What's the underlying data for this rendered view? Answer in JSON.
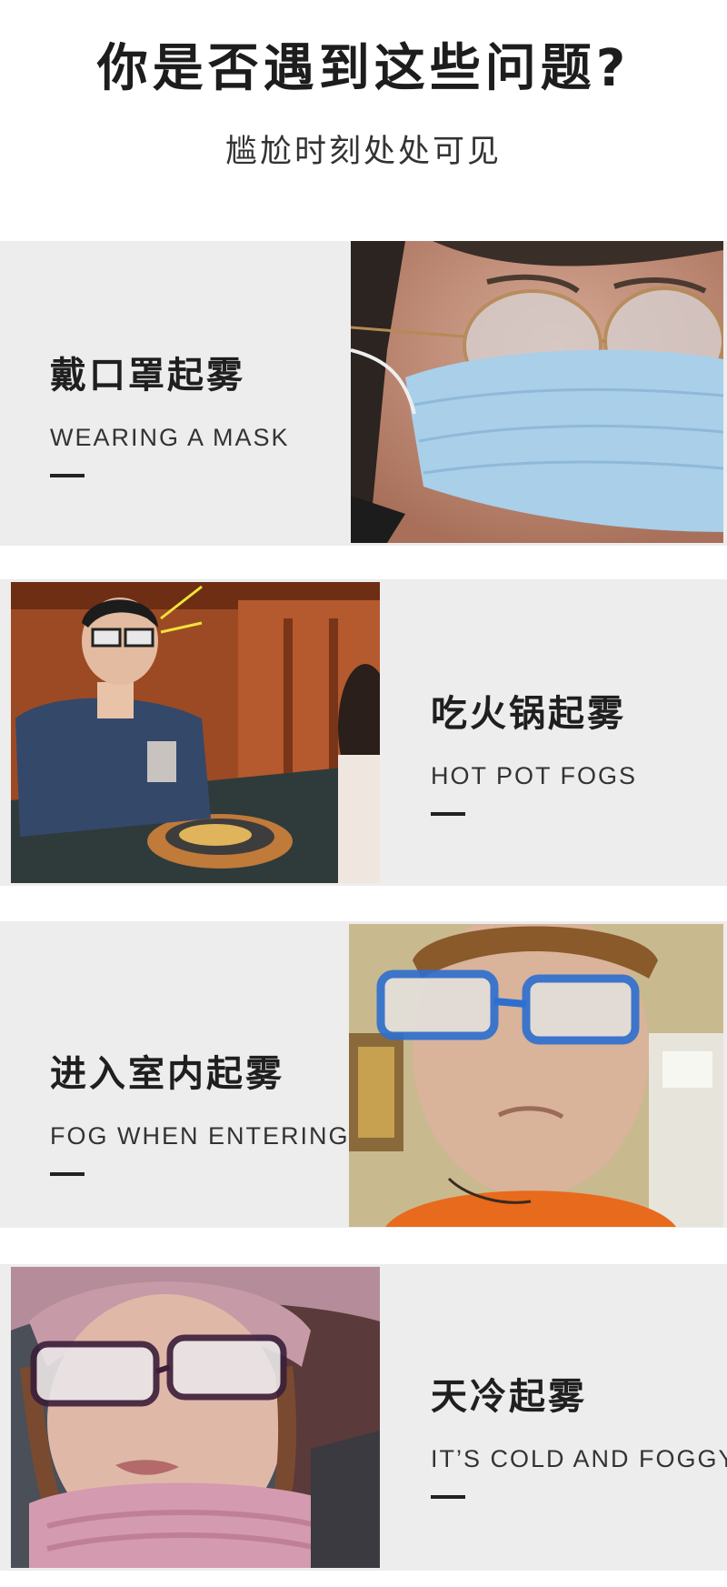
{
  "header": {
    "title": "你是否遇到这些问题?",
    "subtitle": "尴尬时刻处处可见"
  },
  "sections": [
    {
      "cn": "戴口罩起雾",
      "en": "WEARING A MASK"
    },
    {
      "cn": "吃火锅起雾",
      "en": "HOT POT FOGS"
    },
    {
      "cn": "进入室内起雾",
      "en": "FOG WHEN ENTERING"
    },
    {
      "cn": "天冷起雾",
      "en": "IT’S COLD AND FOGGY"
    }
  ],
  "colors": {
    "section_bg": "#ededed",
    "text_dark": "#1f1f1f"
  }
}
